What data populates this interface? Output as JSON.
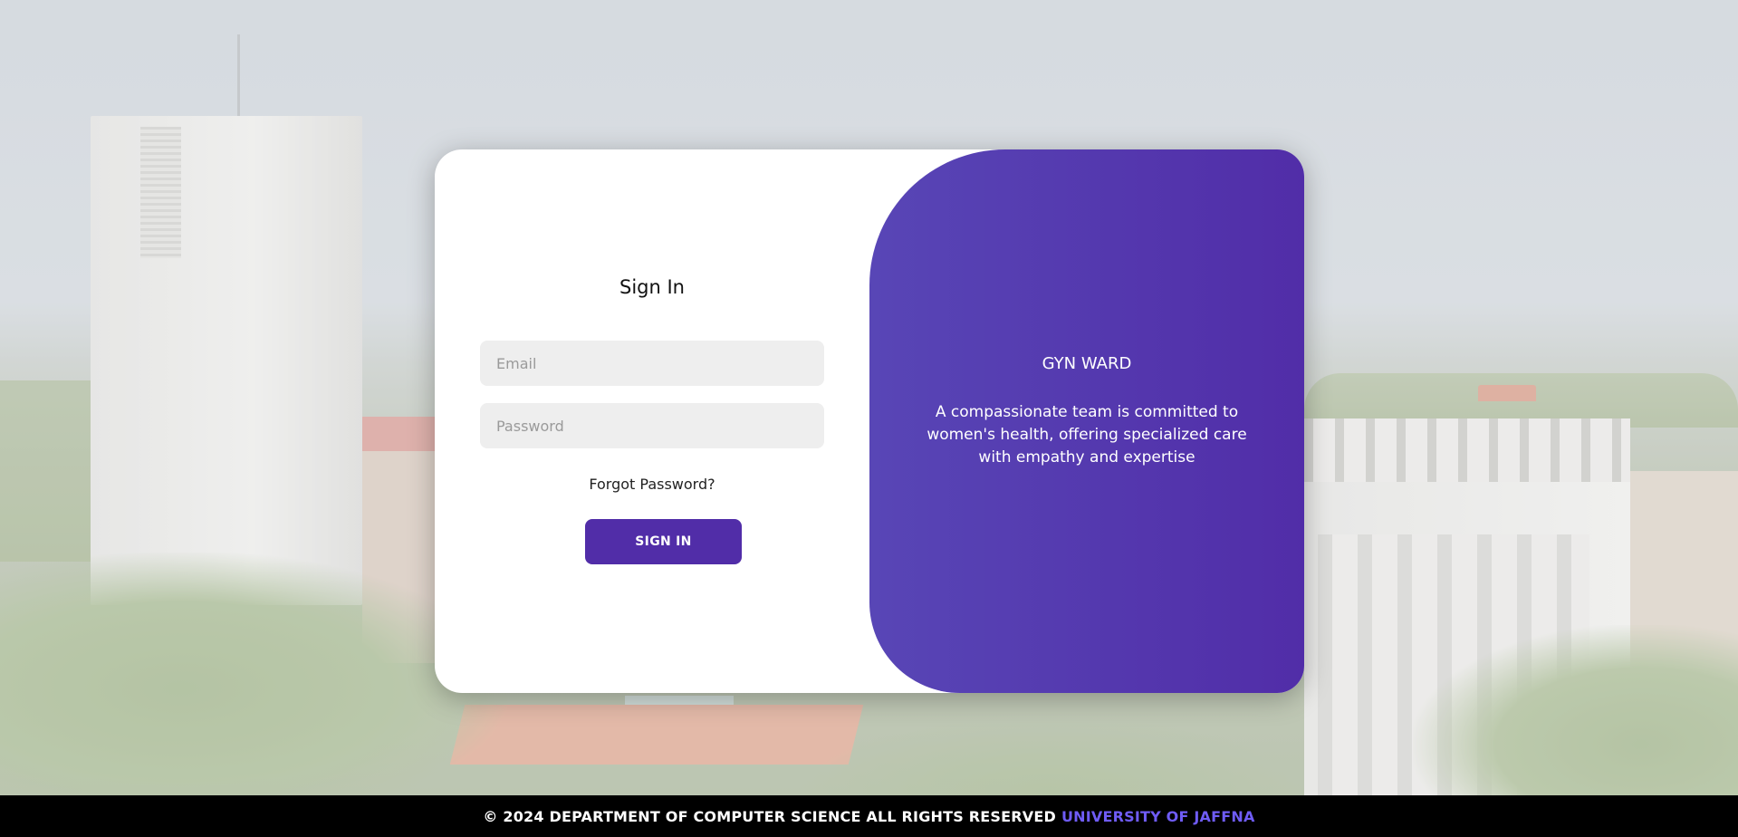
{
  "signin": {
    "title": "Sign In",
    "email_placeholder": "Email",
    "password_placeholder": "Password",
    "forgot_label": "Forgot Password?",
    "button_label": "SIGN IN"
  },
  "panel": {
    "title": "GYN WARD",
    "description": "A compassionate team is committed to women's health, offering specialized care with empathy and expertise"
  },
  "footer": {
    "copyright": "© 2024 DEPARTMENT OF COMPUTER SCIENCE ALL RIGHTS RESERVED",
    "university": "UNIVERSITY OF JAFFNA"
  },
  "colors": {
    "accent": "#512da8",
    "footer_link": "#6f5cf6"
  }
}
